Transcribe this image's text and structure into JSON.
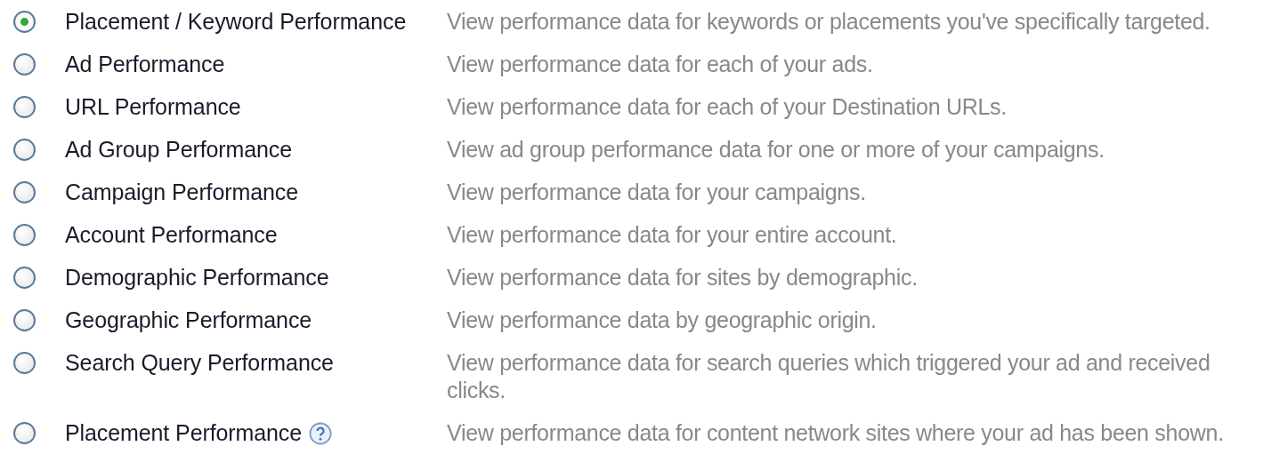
{
  "report_types": [
    {
      "label": "Placement / Keyword Performance",
      "description": "View performance data for keywords or placements you've specifically targeted.",
      "selected": true
    },
    {
      "label": "Ad Performance",
      "description": "View performance data for each of your ads.",
      "selected": false
    },
    {
      "label": "URL Performance",
      "description": "View performance data for each of your Destination URLs.",
      "selected": false
    },
    {
      "label": "Ad Group Performance",
      "description": "View ad group performance data for one or more of your campaigns.",
      "selected": false
    },
    {
      "label": "Campaign Performance",
      "description": "View performance data for your campaigns.",
      "selected": false
    },
    {
      "label": "Account Performance",
      "description": "View performance data for your entire account.",
      "selected": false
    },
    {
      "label": "Demographic Performance",
      "description": "View performance data for sites by demographic.",
      "selected": false
    },
    {
      "label": "Geographic Performance",
      "description": "View performance data by geographic origin.",
      "selected": false
    },
    {
      "label": "Search Query Performance",
      "description": "View performance data for search queries which triggered your ad and received clicks.",
      "selected": false
    },
    {
      "label": "Placement Performance",
      "description": "View performance data for content network sites where your ad has been shown.",
      "selected": false,
      "help": true
    }
  ]
}
